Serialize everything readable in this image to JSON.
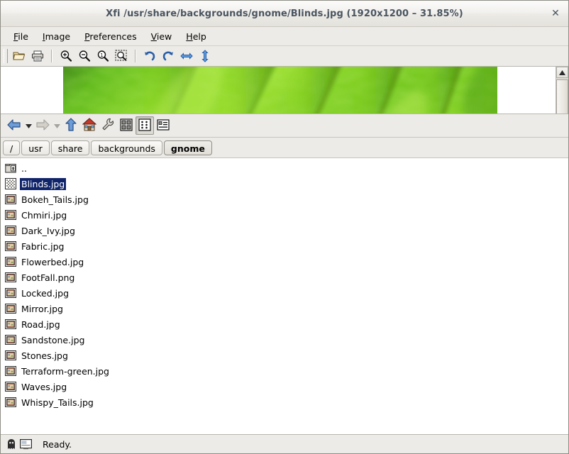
{
  "window": {
    "title": "Xfi /usr/share/backgrounds/gnome/Blinds.jpg (1920x1200 – 31.85%)",
    "close_label": "✕"
  },
  "menubar": {
    "items": [
      {
        "label": "File",
        "mnemonic": "F"
      },
      {
        "label": "Image",
        "mnemonic": "I"
      },
      {
        "label": "Preferences",
        "mnemonic": "P"
      },
      {
        "label": "View",
        "mnemonic": "V"
      },
      {
        "label": "Help",
        "mnemonic": "H"
      }
    ]
  },
  "image_toolbar": {
    "buttons": [
      {
        "name": "open-file-button",
        "icon": "folder-open-icon"
      },
      {
        "name": "print-button",
        "icon": "printer-icon"
      },
      {
        "name": "zoom-in-button",
        "icon": "zoom-in-icon"
      },
      {
        "name": "zoom-out-button",
        "icon": "zoom-out-icon"
      },
      {
        "name": "zoom-actual-size-button",
        "icon": "zoom-one-to-one-icon"
      },
      {
        "name": "zoom-selection-button",
        "icon": "zoom-selection-icon"
      },
      {
        "name": "rotate-left-button",
        "icon": "rotate-left-icon"
      },
      {
        "name": "rotate-right-button",
        "icon": "rotate-right-icon"
      },
      {
        "name": "flip-horizontal-button",
        "icon": "flip-horizontal-icon"
      },
      {
        "name": "flip-vertical-button",
        "icon": "flip-vertical-icon"
      }
    ]
  },
  "image_view": {
    "file_name": "Blinds.jpg",
    "dimensions": "1920x1200",
    "zoom_percent": "31.85%",
    "subject": "green leaf macro with diagonal veins",
    "colors": {
      "light_green": "#8fd425",
      "mid_green": "#63c018",
      "dark_green": "#3f8f11",
      "vein_green": "#2e6b0c",
      "highlight_green": "#b6e84a",
      "canvas_background": "#ffffff"
    }
  },
  "nav_toolbar": {
    "buttons": [
      {
        "name": "back-button",
        "icon": "arrow-left-icon",
        "enabled": true
      },
      {
        "name": "back-history-dropdown",
        "icon": "chevron-down-icon",
        "enabled": true
      },
      {
        "name": "forward-button",
        "icon": "arrow-right-icon",
        "enabled": false
      },
      {
        "name": "forward-history-dropdown",
        "icon": "chevron-down-icon",
        "enabled": false
      },
      {
        "name": "parent-folder-button",
        "icon": "arrow-up-icon",
        "enabled": true
      },
      {
        "name": "home-button",
        "icon": "home-icon",
        "enabled": true
      },
      {
        "name": "tools-button",
        "icon": "wrench-icon",
        "enabled": true
      },
      {
        "name": "view-icons-button",
        "icon": "grid-view-icon",
        "enabled": true,
        "pressed": false
      },
      {
        "name": "view-list-button",
        "icon": "list-view-icon",
        "enabled": true,
        "pressed": true
      },
      {
        "name": "view-details-button",
        "icon": "details-view-icon",
        "enabled": true,
        "pressed": false
      }
    ]
  },
  "breadcrumbs": [
    {
      "label": "/",
      "active": false
    },
    {
      "label": "usr",
      "active": false
    },
    {
      "label": "share",
      "active": false
    },
    {
      "label": "backgrounds",
      "active": false
    },
    {
      "label": "gnome",
      "active": true
    }
  ],
  "files": [
    {
      "label": "..",
      "icon": "parent-folder-icon",
      "selected": false
    },
    {
      "label": "Blinds.jpg",
      "icon": "loading-image-icon",
      "selected": true
    },
    {
      "label": "Bokeh_Tails.jpg",
      "icon": "image-file-icon",
      "selected": false
    },
    {
      "label": "Chmiri.jpg",
      "icon": "image-file-icon",
      "selected": false
    },
    {
      "label": "Dark_Ivy.jpg",
      "icon": "image-file-icon",
      "selected": false
    },
    {
      "label": "Fabric.jpg",
      "icon": "image-file-icon",
      "selected": false
    },
    {
      "label": "Flowerbed.jpg",
      "icon": "image-file-icon",
      "selected": false
    },
    {
      "label": "FootFall.png",
      "icon": "image-file-icon",
      "selected": false
    },
    {
      "label": "Locked.jpg",
      "icon": "image-file-icon",
      "selected": false
    },
    {
      "label": "Mirror.jpg",
      "icon": "image-file-icon",
      "selected": false
    },
    {
      "label": "Road.jpg",
      "icon": "image-file-icon",
      "selected": false
    },
    {
      "label": "Sandstone.jpg",
      "icon": "image-file-icon",
      "selected": false
    },
    {
      "label": "Stones.jpg",
      "icon": "image-file-icon",
      "selected": false
    },
    {
      "label": "Terraform-green.jpg",
      "icon": "image-file-icon",
      "selected": false
    },
    {
      "label": "Waves.jpg",
      "icon": "image-file-icon",
      "selected": false
    },
    {
      "label": "Whispy_Tails.jpg",
      "icon": "image-file-icon",
      "selected": false
    }
  ],
  "statusbar": {
    "text": "Ready.",
    "icons": [
      "ghost-icon",
      "monitor-icon"
    ]
  }
}
